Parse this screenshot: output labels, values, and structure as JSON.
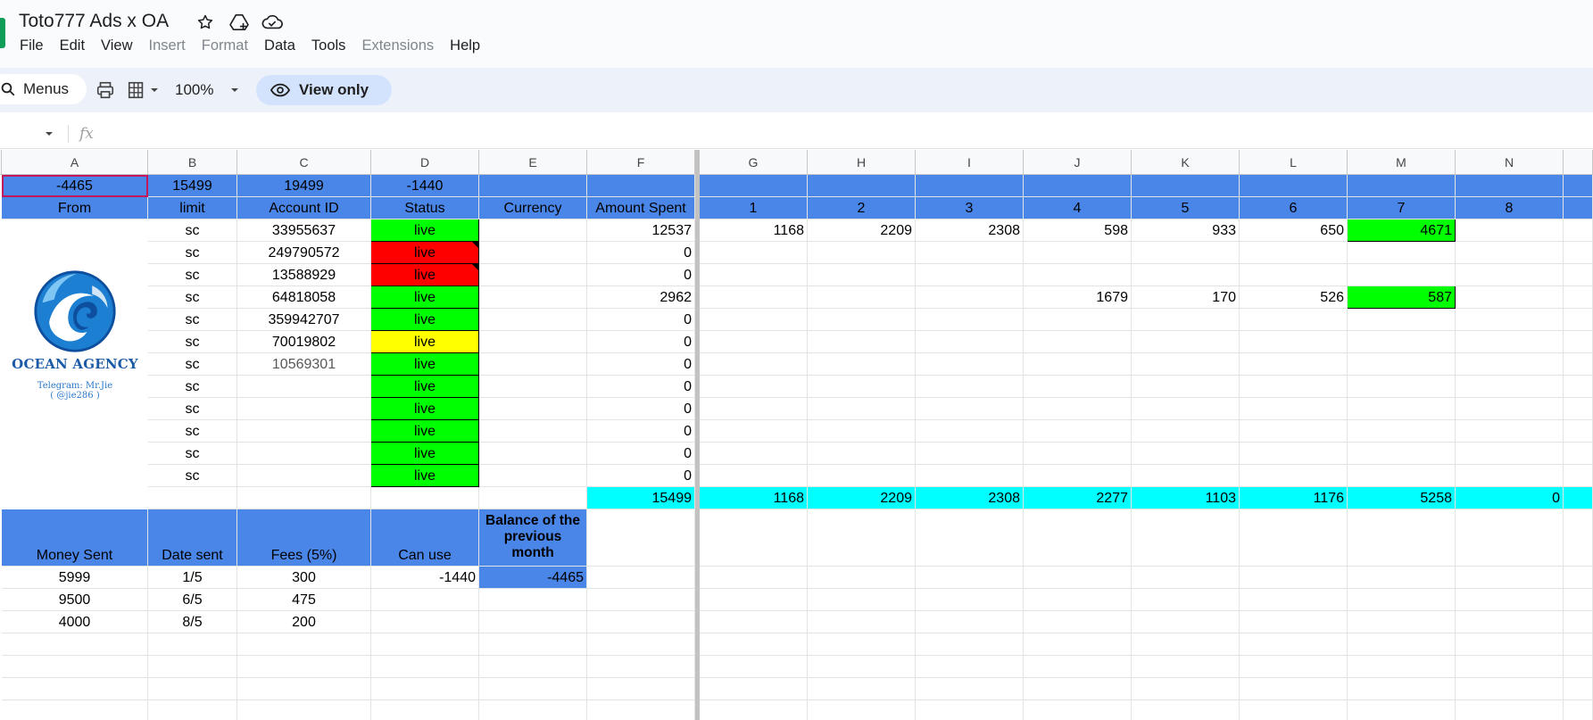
{
  "app": {
    "title": "Toto777 Ads x OA",
    "menu": [
      {
        "label": "File",
        "enabled": true
      },
      {
        "label": "Edit",
        "enabled": true
      },
      {
        "label": "View",
        "enabled": true
      },
      {
        "label": "Insert",
        "enabled": false
      },
      {
        "label": "Format",
        "enabled": false
      },
      {
        "label": "Data",
        "enabled": true
      },
      {
        "label": "Tools",
        "enabled": true
      },
      {
        "label": "Extensions",
        "enabled": false
      },
      {
        "label": "Help",
        "enabled": true
      }
    ]
  },
  "toolbar": {
    "menus_label": "Menus",
    "zoom": "100%",
    "view_only_label": "View only"
  },
  "formula_bar": {
    "fx": "fx",
    "cell_ref": "",
    "content": ""
  },
  "sheet": {
    "columns": [
      "A",
      "B",
      "C",
      "D",
      "E",
      "F",
      "G",
      "H",
      "I",
      "J",
      "K",
      "L",
      "M",
      "N"
    ],
    "summary_row": [
      "-4465",
      "15499",
      "19499",
      "-1440"
    ],
    "headers": [
      "From",
      "limit",
      "Account ID",
      "Status",
      "Currency",
      "Amount Spent",
      "1",
      "2",
      "3",
      "4",
      "5",
      "6",
      "7",
      "8"
    ],
    "accounts": [
      {
        "limit": "sc",
        "id": "33955637",
        "status": "live",
        "status_color": "green",
        "spent": "12537",
        "days": [
          "1168",
          "2209",
          "2308",
          "598",
          "933",
          "650",
          "4671",
          ""
        ]
      },
      {
        "limit": "sc",
        "id": "249790572",
        "status": "live",
        "status_color": "red",
        "spent": "0",
        "days": [
          "",
          "",
          "",
          "",
          "",
          "",
          "",
          ""
        ]
      },
      {
        "limit": "sc",
        "id": "13588929",
        "status": "live",
        "status_color": "red",
        "spent": "0",
        "days": [
          "",
          "",
          "",
          "",
          "",
          "",
          "",
          ""
        ]
      },
      {
        "limit": "sc",
        "id": "64818058",
        "status": "live",
        "status_color": "green",
        "spent": "2962",
        "days": [
          "",
          "",
          "",
          "1679",
          "170",
          "526",
          "587",
          ""
        ]
      },
      {
        "limit": "sc",
        "id": "359942707",
        "status": "live",
        "status_color": "green",
        "spent": "0",
        "days": [
          "",
          "",
          "",
          "",
          "",
          "",
          "",
          ""
        ]
      },
      {
        "limit": "sc",
        "id": "70019802",
        "status": "live",
        "status_color": "yellow",
        "spent": "0",
        "days": [
          "",
          "",
          "",
          "",
          "",
          "",
          "",
          ""
        ]
      },
      {
        "limit": "sc",
        "id": "10569301",
        "status": "live",
        "status_color": "green",
        "spent": "0",
        "days": [
          "",
          "",
          "",
          "",
          "",
          "",
          "",
          ""
        ]
      },
      {
        "limit": "sc",
        "id": "",
        "status": "live",
        "status_color": "green",
        "spent": "0",
        "days": [
          "",
          "",
          "",
          "",
          "",
          "",
          "",
          ""
        ]
      },
      {
        "limit": "sc",
        "id": "",
        "status": "live",
        "status_color": "green",
        "spent": "0",
        "days": [
          "",
          "",
          "",
          "",
          "",
          "",
          "",
          ""
        ]
      },
      {
        "limit": "sc",
        "id": "",
        "status": "live",
        "status_color": "green",
        "spent": "0",
        "days": [
          "",
          "",
          "",
          "",
          "",
          "",
          "",
          ""
        ]
      },
      {
        "limit": "sc",
        "id": "",
        "status": "live",
        "status_color": "green",
        "spent": "0",
        "days": [
          "",
          "",
          "",
          "",
          "",
          "",
          "",
          ""
        ]
      },
      {
        "limit": "sc",
        "id": "",
        "status": "live",
        "status_color": "green",
        "spent": "0",
        "days": [
          "",
          "",
          "",
          "",
          "",
          "",
          "",
          ""
        ]
      }
    ],
    "totals": [
      "15499",
      "1168",
      "2209",
      "2308",
      "2277",
      "1103",
      "1176",
      "5258",
      "0"
    ],
    "logo": {
      "name": "OCEAN AGENCY",
      "telegram_line1": "Telegram: Mr.Jie",
      "telegram_line2": "( @jie286 )"
    },
    "money_headers": [
      "Money Sent",
      "Date sent",
      "Fees (5%)",
      "Can use",
      "Balance of the previous month"
    ],
    "money_rows": [
      [
        "5999",
        "1/5",
        "300",
        "-1440",
        "-4465"
      ],
      [
        "9500",
        "6/5",
        "475",
        "",
        ""
      ],
      [
        "4000",
        "8/5",
        "200",
        "",
        ""
      ]
    ],
    "colors": {
      "header_blue": "#4a86e8",
      "live_green": "#00ff00",
      "live_red": "#ff0000",
      "live_yellow": "#ffff00",
      "total_cyan": "#00ffff"
    }
  }
}
